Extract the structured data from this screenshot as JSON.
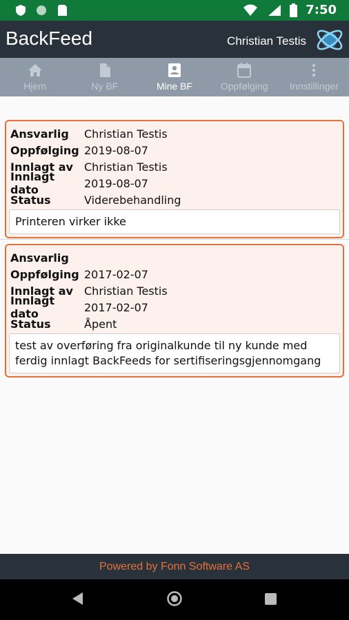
{
  "statusbar": {
    "time": "7:50"
  },
  "appbar": {
    "title": "BackFeed",
    "user": "Christian Testis"
  },
  "tabs": [
    {
      "label": "Hjem",
      "icon": "home-icon"
    },
    {
      "label": "Ny BF",
      "icon": "document-icon"
    },
    {
      "label": "Mine BF",
      "icon": "contact-card-icon",
      "active": true
    },
    {
      "label": "Oppfølging",
      "icon": "calendar-icon"
    },
    {
      "label": "Innstillinger",
      "icon": "more-vertical-icon"
    }
  ],
  "labels": {
    "responsible": "Ansvarlig",
    "followup": "Oppfølging",
    "entered_by": "Innlagt av",
    "entered_date": "Innlagt dato",
    "status": "Status"
  },
  "items": [
    {
      "responsible": "Christian Testis",
      "followup": "2019-08-07",
      "entered_by": "Christian Testis",
      "entered_date": "2019-08-07",
      "status": "Viderebehandling",
      "description": "Printeren virker ikke"
    },
    {
      "responsible": "",
      "followup": "2017-02-07",
      "entered_by": "Christian Testis",
      "entered_date": "2017-02-07",
      "status": "Åpent",
      "description": "test av overføring fra originalkunde til ny kunde med ferdig innlagt BackFeeds for sertifiseringsgjennomgang"
    }
  ],
  "footer": {
    "text": "Powered by Fonn Software AS"
  },
  "colors": {
    "statusbar": "#0f7a3a",
    "appbar": "#29313b",
    "tabs": "#8e9aa8",
    "accent": "#e5703a",
    "card_bg": "#fdf1ee"
  }
}
